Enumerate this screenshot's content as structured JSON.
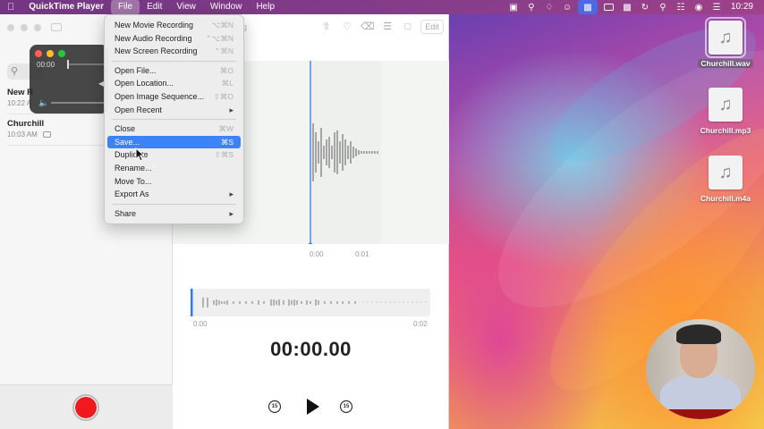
{
  "menubar": {
    "app_name": "QuickTime Player",
    "menus": [
      "File",
      "Edit",
      "View",
      "Window",
      "Help"
    ],
    "active_menu": "File",
    "clock": "10:29"
  },
  "file_menu": {
    "items": [
      {
        "label": "New Movie Recording",
        "shortcut": "⌥⌘N"
      },
      {
        "label": "New Audio Recording",
        "shortcut": "⌃⌥⌘N"
      },
      {
        "label": "New Screen Recording",
        "shortcut": "⌃⌘N"
      },
      {
        "label": "Open File...",
        "shortcut": "⌘O"
      },
      {
        "label": "Open Location...",
        "shortcut": "⌘L"
      },
      {
        "label": "Open Image Sequence...",
        "shortcut": "⇧⌘O"
      },
      {
        "label": "Open Recent",
        "shortcut": ""
      },
      {
        "label": "Close",
        "shortcut": "⌘W"
      },
      {
        "label": "Save...",
        "shortcut": "⌘S"
      },
      {
        "label": "Duplicate",
        "shortcut": "⇧⌘S"
      },
      {
        "label": "Rename...",
        "shortcut": ""
      },
      {
        "label": "Move To...",
        "shortcut": ""
      },
      {
        "label": "Export As",
        "shortcut": ""
      },
      {
        "label": "Share",
        "shortcut": ""
      }
    ],
    "selected_item": "Save..."
  },
  "quicktime_window": {
    "time": "00:00"
  },
  "voice_memos": {
    "search_placeholder": "Search",
    "window_title_fragment": "g",
    "recordings": [
      {
        "title": "New R",
        "time": "10:22 A"
      },
      {
        "title": "Churchill",
        "time": "10:03 AM"
      }
    ],
    "edit_label": "Edit",
    "wave_ticks": [
      "0:00",
      "0:01"
    ],
    "overview_start": "0:00",
    "overview_end": "0:02",
    "timer": "00:00.00",
    "skip_back_label": "15",
    "skip_forward_label": "15"
  },
  "desktop_files": [
    {
      "name": "Churchill.wav",
      "icon": "music-note-icon",
      "selected": true
    },
    {
      "name": "Churchill.mp3",
      "icon": "music-note-icon",
      "selected": false
    },
    {
      "name": "Churchill.m4a",
      "icon": "music-note-icon",
      "selected": false
    }
  ],
  "colors": {
    "record_red": "#f0191e",
    "menu_highlight": "#3e82f7",
    "playhead_blue": "#3478f6"
  }
}
